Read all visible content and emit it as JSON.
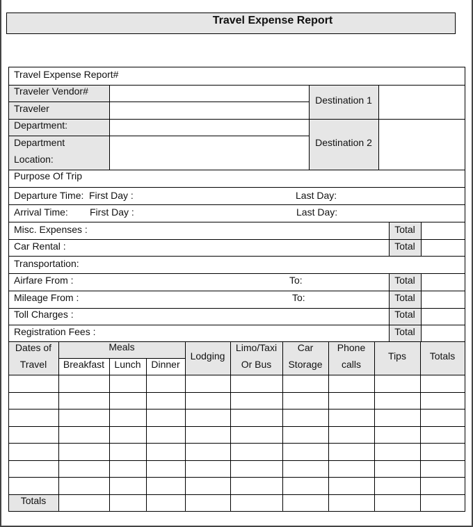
{
  "title": "Travel Expense Report",
  "header_fields": {
    "report_number": "Travel Expense Report#",
    "traveler_vendor": "Traveler Vendor#",
    "traveler": "Traveler",
    "department": "Department:",
    "department_location_line1": "Department",
    "department_location_line2": "Location:",
    "destination_1": "Destination 1",
    "destination_2": "Destination 2",
    "purpose": "Purpose Of Trip"
  },
  "times": {
    "departure_label": "Departure Time:",
    "arrival_label": "Arrival Time:",
    "first_day": "First Day :",
    "last_day": "Last Day:"
  },
  "expenses": {
    "misc": "Misc. Expenses :",
    "car_rental": "Car Rental :",
    "transportation": "Transportation:",
    "airfare_from": "Airfare From :",
    "mileage_from": "Mileage From :",
    "to": "To:",
    "toll": "Toll Charges :",
    "registration": "Registration Fees :",
    "total": "Total"
  },
  "grid": {
    "dates_line1": "Dates of",
    "dates_line2": "Travel",
    "meals": "Meals",
    "breakfast": "Breakfast",
    "lunch": "Lunch",
    "dinner": "Dinner",
    "lodging": "Lodging",
    "limo_line1": "Limo/Taxi",
    "limo_line2": "Or Bus",
    "car_line1": "Car",
    "car_line2": "Storage",
    "phone_line1": "Phone",
    "phone_line2": "calls",
    "tips": "Tips",
    "totals_col": "Totals",
    "totals_row": "Totals",
    "empty_rows": 7
  }
}
